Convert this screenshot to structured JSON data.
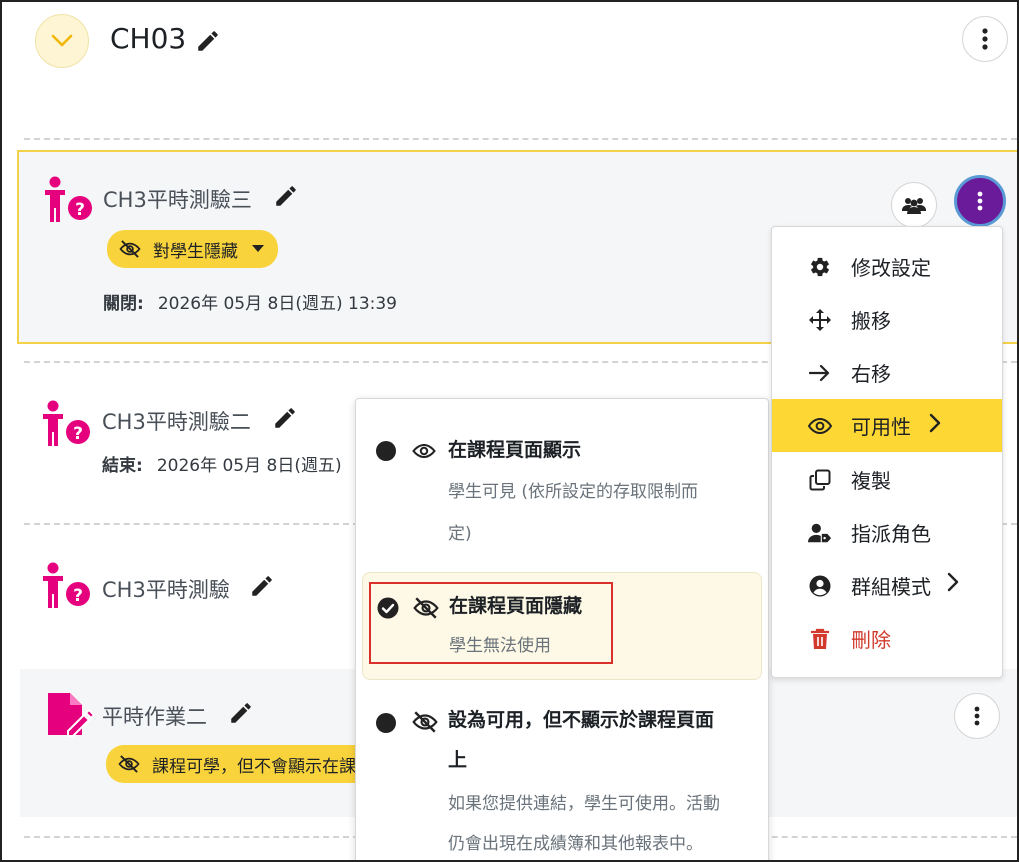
{
  "section": {
    "title": "CH03"
  },
  "activities": [
    {
      "title": "CH3平時測驗三",
      "badge": "對學生隱藏",
      "date_label": "關閉:",
      "date_value": "2026年 05月 8日(週五) 13:39"
    },
    {
      "title": "CH3平時測驗二",
      "date_label": "結束:",
      "date_value": "2026年 05月 8日(週五)"
    },
    {
      "title": "CH3平時測驗"
    },
    {
      "title": "平時作業二",
      "badge": "課程可學，但不會顯示在課"
    }
  ],
  "action_menu": {
    "items": [
      {
        "label": "修改設定",
        "icon": "gear-icon"
      },
      {
        "label": "搬移",
        "icon": "move-icon"
      },
      {
        "label": "右移",
        "icon": "arrow-right-icon"
      },
      {
        "label": "可用性",
        "icon": "eye-icon"
      },
      {
        "label": "複製",
        "icon": "copy-icon"
      },
      {
        "label": "指派角色",
        "icon": "user-tag-icon"
      },
      {
        "label": "群組模式",
        "icon": "user-circle-icon"
      },
      {
        "label": "刪除",
        "icon": "trash-icon"
      }
    ],
    "active_item": "可用性"
  },
  "availability_menu": {
    "options": [
      {
        "title": "在課程頁面顯示",
        "desc_line1": "學生可見 (依所設定的存取限制而",
        "desc_line2": "定)"
      },
      {
        "title": "在課程頁面隱藏",
        "desc_line1": "學生無法使用"
      },
      {
        "title_line1": "設為可用，但不顯示於課程頁面",
        "title_line2": "上",
        "desc_line1": "如果您提供連結，學生可使用。活動",
        "desc_line2": "仍會出現在成績簿和其他報表中。"
      }
    ],
    "selected": "在課程頁面隱藏"
  },
  "colors": {
    "accent_yellow": "#fdd835",
    "badge_yellow": "#f9d33c",
    "highlight_border": "#f3d24a",
    "kebab_purple": "#6a1b9a",
    "icon_pink": "#e5007e",
    "danger_red": "#d23a2e"
  }
}
